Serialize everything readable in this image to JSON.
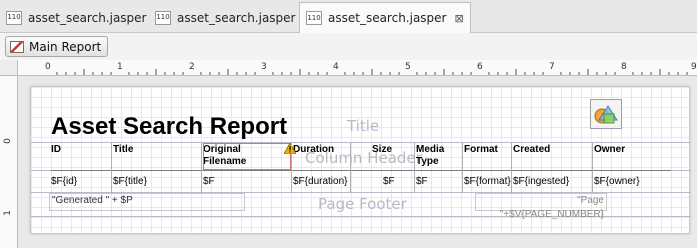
{
  "tabs": [
    {
      "label": "asset_search.jasper",
      "icon": "jasper-file-icon",
      "active": false
    },
    {
      "label": "asset_search.jasper",
      "icon": "jasper-file-icon",
      "active": false
    },
    {
      "label": "asset_search.jasper",
      "icon": "jasper-file-icon",
      "active": true
    }
  ],
  "tab_icon_text": "110",
  "toolbar": {
    "main_report_label": "Main Report"
  },
  "ruler": {
    "h_numbers": [
      "0",
      "1",
      "2",
      "3",
      "4",
      "5",
      "6",
      "7",
      "8",
      "9"
    ],
    "v_numbers": [
      "0",
      "1"
    ]
  },
  "report": {
    "title": "Asset Search Report",
    "band_labels": {
      "title": "Title",
      "column_header": "Column Header",
      "page_footer": "Page Footer"
    },
    "columns": [
      {
        "header": "ID",
        "field": "$F{id}"
      },
      {
        "header": "Title",
        "field": "$F{title}"
      },
      {
        "header": "Original Filename",
        "field": "$F"
      },
      {
        "header": "Duration",
        "field": "$F{duration}"
      },
      {
        "header": "Size",
        "field": "$F"
      },
      {
        "header": "Media Type",
        "field": "$F"
      },
      {
        "header": "Format",
        "field": "$F{format}"
      },
      {
        "header": "Created",
        "field": "$F{ingested}"
      },
      {
        "header": "Owner",
        "field": "$F{owner}"
      }
    ],
    "footer_left": "\"Generated \" + $P",
    "footer_right": "\"Page \"+$V{PAGE_NUMBER}"
  },
  "colors": {
    "selection": "#e07070",
    "warning": "#f0b400",
    "grid": "#e7e7ef"
  }
}
